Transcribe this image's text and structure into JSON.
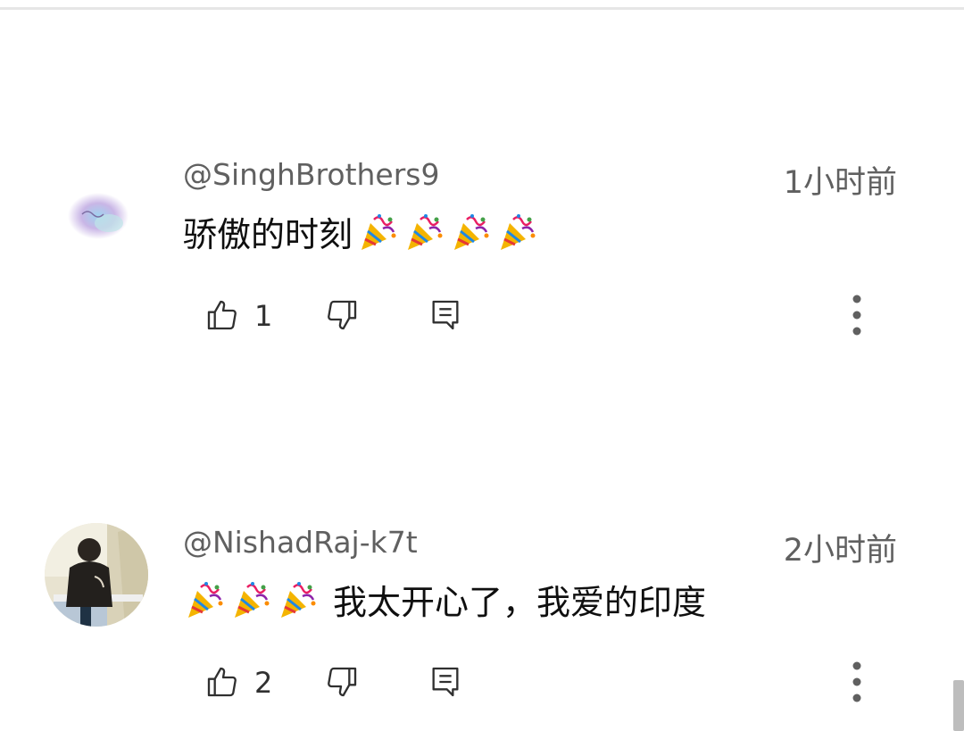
{
  "comments": [
    {
      "author": "@SinghBrothers9",
      "time": "1小时前",
      "text": "骄傲的时刻",
      "emoji_before": 0,
      "emoji_after": 4,
      "likes": "1",
      "avatar": "singh-logo-avatar"
    },
    {
      "author": "@NishadRaj-k7t",
      "time": "2小时前",
      "text": "我太开心了，我爱的印度",
      "emoji_before": 3,
      "emoji_after": 0,
      "likes": "2",
      "avatar": "photo-avatar"
    }
  ],
  "icons": {
    "like": "thumbs-up-icon",
    "dislike": "thumbs-down-icon",
    "reply": "reply-icon",
    "more": "more-vert-icon",
    "emoji": "party-popper-icon"
  }
}
